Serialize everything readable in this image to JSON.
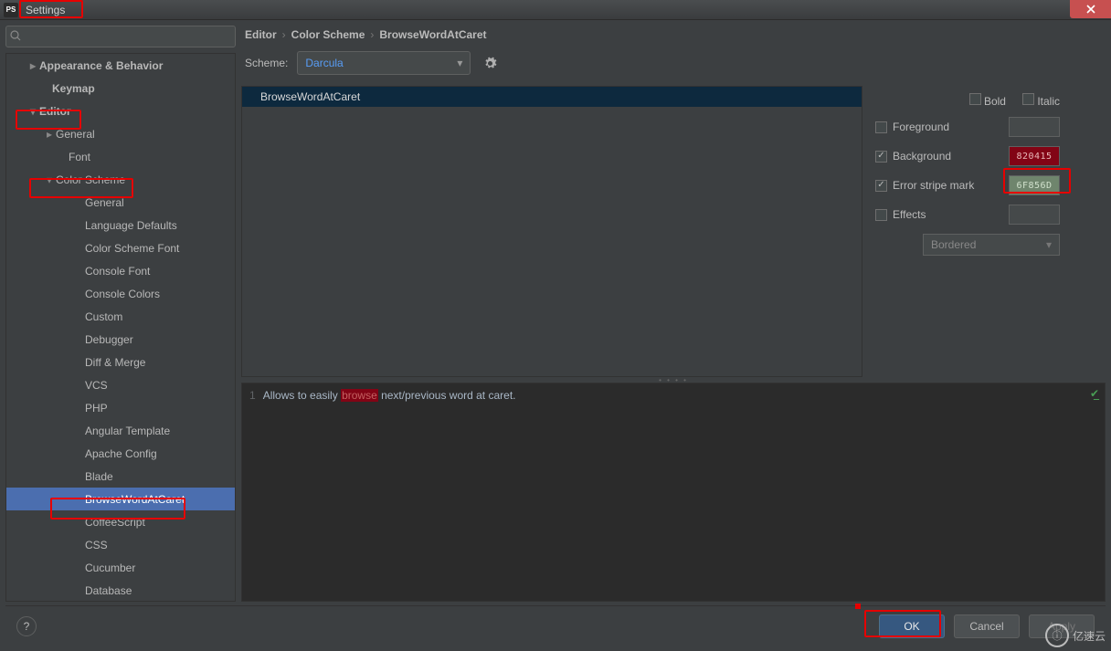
{
  "window": {
    "title": "Settings",
    "app_badge": "PS"
  },
  "search": {
    "placeholder": ""
  },
  "tree": [
    {
      "label": "Appearance & Behavior",
      "indent": 22,
      "arrow": "right",
      "bold": true
    },
    {
      "label": "Keymap",
      "indent": 36,
      "arrow": "",
      "bold": true
    },
    {
      "label": "Editor",
      "indent": 22,
      "arrow": "down",
      "bold": true
    },
    {
      "label": "General",
      "indent": 40,
      "arrow": "right",
      "bold": false
    },
    {
      "label": "Font",
      "indent": 54,
      "arrow": "",
      "bold": false
    },
    {
      "label": "Color Scheme",
      "indent": 40,
      "arrow": "down",
      "bold": false
    },
    {
      "label": "General",
      "indent": 72,
      "arrow": "",
      "bold": false
    },
    {
      "label": "Language Defaults",
      "indent": 72,
      "arrow": "",
      "bold": false
    },
    {
      "label": "Color Scheme Font",
      "indent": 72,
      "arrow": "",
      "bold": false
    },
    {
      "label": "Console Font",
      "indent": 72,
      "arrow": "",
      "bold": false
    },
    {
      "label": "Console Colors",
      "indent": 72,
      "arrow": "",
      "bold": false
    },
    {
      "label": "Custom",
      "indent": 72,
      "arrow": "",
      "bold": false
    },
    {
      "label": "Debugger",
      "indent": 72,
      "arrow": "",
      "bold": false
    },
    {
      "label": "Diff & Merge",
      "indent": 72,
      "arrow": "",
      "bold": false
    },
    {
      "label": "VCS",
      "indent": 72,
      "arrow": "",
      "bold": false
    },
    {
      "label": "PHP",
      "indent": 72,
      "arrow": "",
      "bold": false
    },
    {
      "label": "Angular Template",
      "indent": 72,
      "arrow": "",
      "bold": false
    },
    {
      "label": "Apache Config",
      "indent": 72,
      "arrow": "",
      "bold": false
    },
    {
      "label": "Blade",
      "indent": 72,
      "arrow": "",
      "bold": false
    },
    {
      "label": "BrowseWordAtCaret",
      "indent": 72,
      "arrow": "",
      "bold": false,
      "selected": true
    },
    {
      "label": "CoffeeScript",
      "indent": 72,
      "arrow": "",
      "bold": false
    },
    {
      "label": "CSS",
      "indent": 72,
      "arrow": "",
      "bold": false
    },
    {
      "label": "Cucumber",
      "indent": 72,
      "arrow": "",
      "bold": false
    },
    {
      "label": "Database",
      "indent": 72,
      "arrow": "",
      "bold": false
    }
  ],
  "breadcrumbs": [
    "Editor",
    "Color Scheme",
    "BrowseWordAtCaret"
  ],
  "scheme": {
    "label": "Scheme:",
    "value": "Darcula"
  },
  "attributes_list": [
    "BrowseWordAtCaret"
  ],
  "options": {
    "bold": {
      "label": "Bold",
      "checked": false
    },
    "italic": {
      "label": "Italic",
      "checked": false
    },
    "foreground": {
      "label": "Foreground",
      "checked": false,
      "swatch": ""
    },
    "background": {
      "label": "Background",
      "checked": true,
      "swatch": "820415",
      "swatch_color": "#820415"
    },
    "stripe": {
      "label": "Error stripe mark",
      "checked": true,
      "swatch": "6F856D",
      "swatch_color": "#6f856d"
    },
    "effects": {
      "label": "Effects",
      "checked": false,
      "swatch": ""
    },
    "effects_type": "Bordered"
  },
  "preview": {
    "line_no": "1",
    "pre": "Allows to easily ",
    "word": "browse",
    "post": " next/previous word at caret."
  },
  "footer": {
    "ok": "OK",
    "cancel": "Cancel",
    "apply": "Apply"
  },
  "watermark": "亿速云"
}
